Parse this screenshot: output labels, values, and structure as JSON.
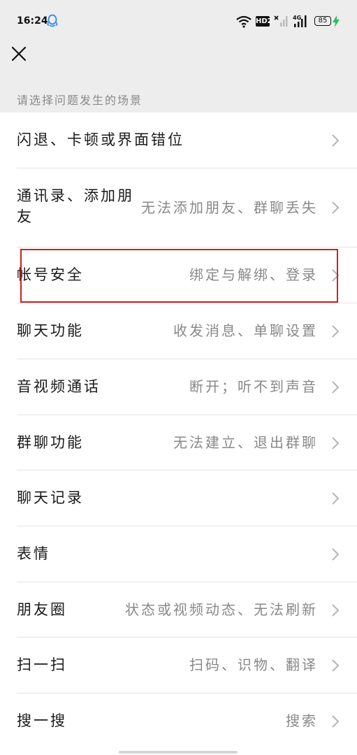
{
  "status_bar": {
    "time": "16:24",
    "hd_label": "HD2",
    "network_label": "4G",
    "battery": "85"
  },
  "header": {
    "section_label": "请选择问题发生的场景"
  },
  "items": [
    {
      "title": "闪退、卡顿或界面错位",
      "subtitle": ""
    },
    {
      "title": "通讯录、添加朋友",
      "subtitle": "无法添加朋友、群聊丢失"
    },
    {
      "title": "帐号安全",
      "subtitle": "绑定与解绑、登录"
    },
    {
      "title": "聊天功能",
      "subtitle": "收发消息、单聊设置"
    },
    {
      "title": "音视频通话",
      "subtitle": "断开；听不到声音"
    },
    {
      "title": "群聊功能",
      "subtitle": "无法建立、退出群聊"
    },
    {
      "title": "聊天记录",
      "subtitle": ""
    },
    {
      "title": "表情",
      "subtitle": ""
    },
    {
      "title": "朋友圈",
      "subtitle": "状态或视频动态、无法刷新"
    },
    {
      "title": "扫一扫",
      "subtitle": "扫码、识物、翻译"
    },
    {
      "title": "搜一搜",
      "subtitle": "搜索"
    }
  ]
}
